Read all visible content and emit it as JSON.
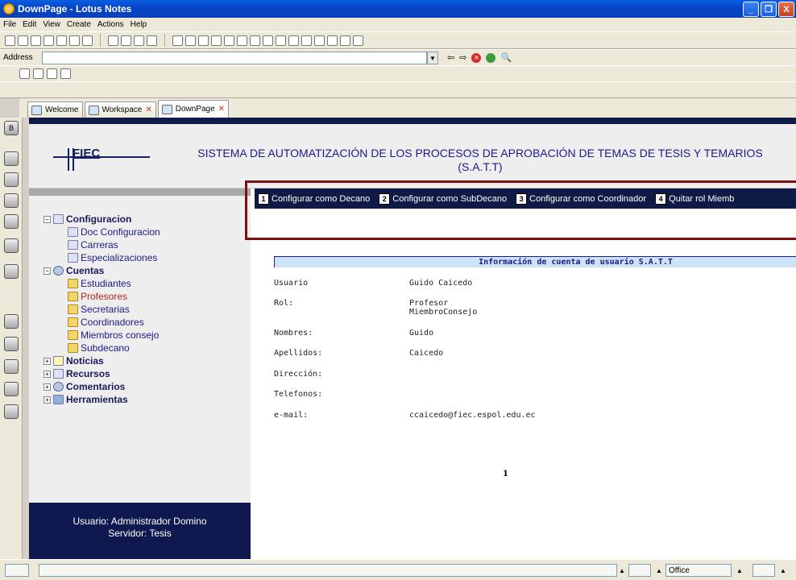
{
  "window": {
    "title": "DownPage - Lotus Notes",
    "buttons": [
      "_",
      "❐",
      "X"
    ]
  },
  "menu": [
    "File",
    "Edit",
    "View",
    "Create",
    "Actions",
    "Help"
  ],
  "address": {
    "label": "Address",
    "value": ""
  },
  "tabs": [
    {
      "label": "Welcome",
      "icon": "welcome-icon",
      "closable": false
    },
    {
      "label": "Workspace",
      "icon": "workspace-icon",
      "closable": true
    },
    {
      "label": "DownPage",
      "icon": "downpage-icon",
      "closable": true,
      "active": true
    }
  ],
  "header": {
    "logo_text": "FIEC",
    "title": "SISTEMA DE AUTOMATIZACIÓN DE LOS PROCESOS DE APROBACIÓN DE TEMAS DE TESIS Y TEMARIOS (S.A.T.T)"
  },
  "nav": {
    "configuracion": {
      "label": "Configuracion",
      "children": [
        "Doc Configuracion",
        "Carreras",
        "Especializaciones"
      ]
    },
    "cuentas": {
      "label": "Cuentas",
      "children": [
        "Estudiantes",
        "Profesores",
        "Secretarias",
        "Coordinadores",
        "Miembros consejo",
        "Subdecano"
      ]
    },
    "noticias": "Noticias",
    "recursos": "Recursos",
    "comentarios": "Comentarios",
    "herramientas": "Herramientas"
  },
  "footer": {
    "user_line": "Usuario: Administrador Domino",
    "server_line": "Servidor: Tesis"
  },
  "actions": [
    {
      "num": "1",
      "label": "Configurar como Decano"
    },
    {
      "num": "2",
      "label": "Configurar como SubDecano"
    },
    {
      "num": "3",
      "label": "Configurar como Coordinador"
    },
    {
      "num": "4",
      "label": "Quitar rol Miemb"
    }
  ],
  "info": {
    "heading": "Información de cuenta de usuario S.A.T.T",
    "usuario_label": "Usuario",
    "usuario_value": "Guido Caicedo",
    "rol_label": "Rol:",
    "rol_value_1": "Profesor",
    "rol_value_2": "MiembroConsejo",
    "nombres_label": "Nombres:",
    "nombres_value": "Guido",
    "apellidos_label": "Apellidos:",
    "apellidos_value": "Caicedo",
    "direccion_label": "Dirección:",
    "direccion_value": "",
    "telefonos_label": "Telefonos:",
    "telefonos_value": "",
    "email_label": "e-mail:",
    "email_value": "ccaicedo@fiec.espol.edu.ec",
    "page_number": "1"
  },
  "status": {
    "location": "Office"
  },
  "colors": {
    "navy": "#0e1b47",
    "frame_red": "#7b1010",
    "info_header_bg": "#cde3f6"
  }
}
